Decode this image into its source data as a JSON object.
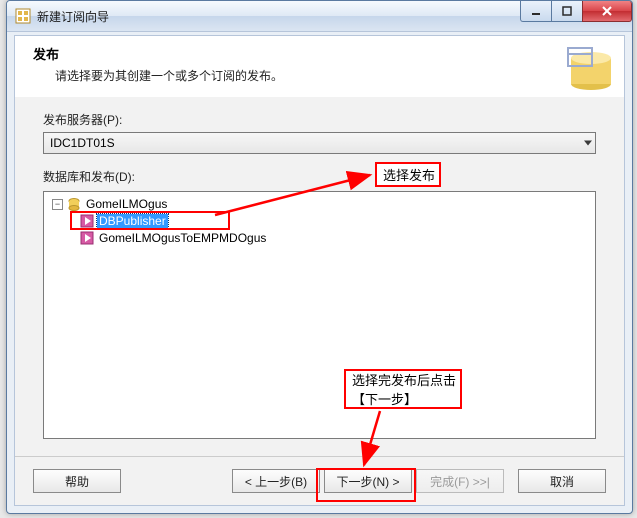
{
  "window": {
    "title": "新建订阅向导"
  },
  "header": {
    "heading": "发布",
    "subheading": "请选择要为其创建一个或多个订阅的发布。"
  },
  "publisher_label": "发布服务器(P):",
  "publisher_value": "IDC1DT01S",
  "tree_label": "数据库和发布(D):",
  "tree": {
    "root": "GomeILMOgus",
    "child_selected": "DBPublisher",
    "child2": "GomeILMOgusToEMPMDOgus"
  },
  "buttons": {
    "help": "帮助",
    "back": "< 上一步(B)",
    "next": "下一步(N) >",
    "finish": "完成(F) >>|",
    "cancel": "取消"
  },
  "annotations": {
    "callout_select_pub": "选择发布",
    "callout_next": "选择完发布后点击\n【下一步】"
  },
  "icons": {
    "app": "app-icon",
    "minimize": "window-minimize-icon",
    "maximize": "window-maximize-icon",
    "close": "window-close-icon",
    "database": "database-icon",
    "publication": "publication-icon",
    "header_art": "header-art-icon"
  }
}
